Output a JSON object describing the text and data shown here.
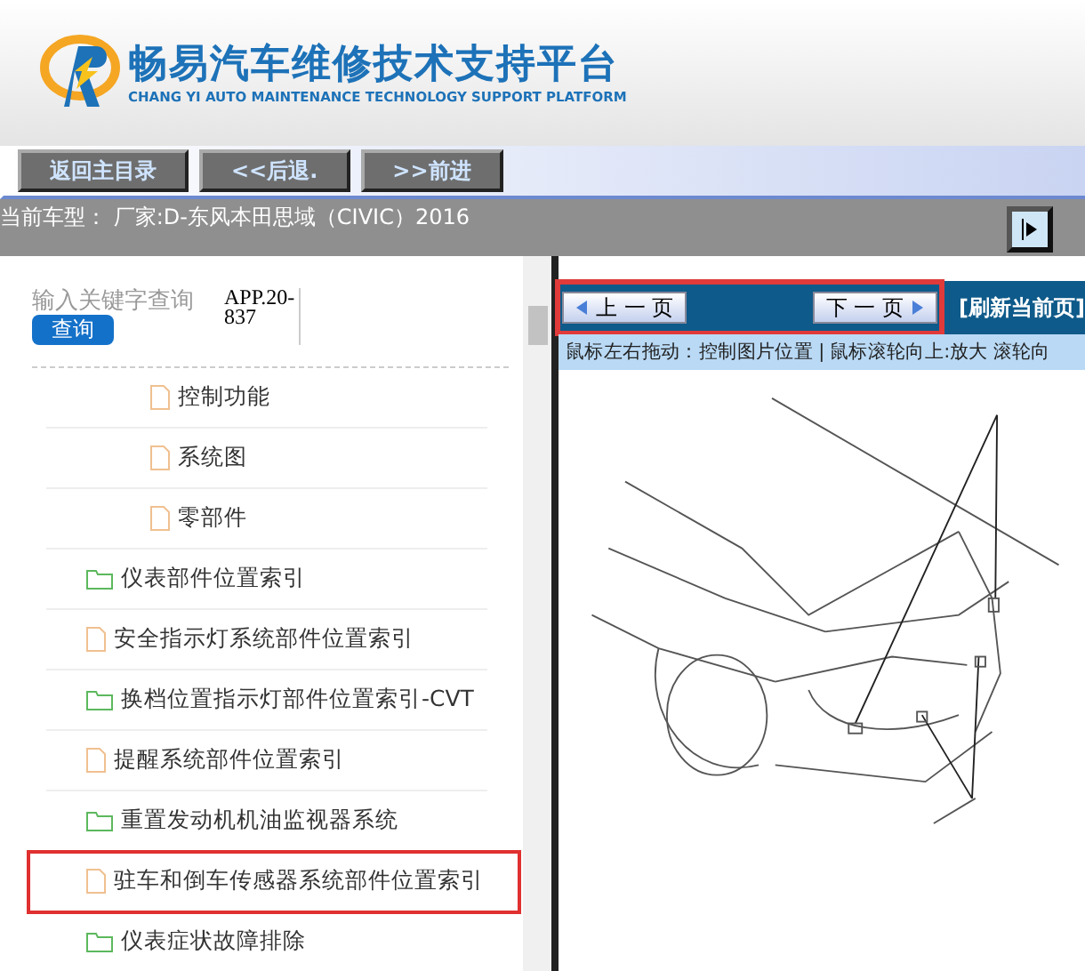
{
  "header": {
    "title": "畅易汽车维修技术支持平台",
    "subtitle": "CHANG YI AUTO MAINTENANCE TECHNOLOGY SUPPORT PLATFORM"
  },
  "toolbar": {
    "buttons": [
      "返回主目录",
      "<<后退.",
      ">>前进"
    ]
  },
  "vehicle_bar": {
    "text": "当前车型：  厂家:D-东风本田思域（CIVIC）2016"
  },
  "search": {
    "placeholder": "输入关键字查询",
    "button": "查询",
    "doc_code": "APP.20-837"
  },
  "tree": [
    {
      "kind": "group",
      "children": [
        {
          "kind": "file",
          "label": "控制功能",
          "highlighted": false
        },
        {
          "kind": "file",
          "label": "系统图",
          "highlighted": false
        },
        {
          "kind": "file",
          "label": "零部件",
          "highlighted": false
        }
      ]
    },
    {
      "kind": "folder",
      "label": "仪表部件位置索引",
      "highlighted": false
    },
    {
      "kind": "file",
      "label": "安全指示灯系统部件位置索引",
      "highlighted": false
    },
    {
      "kind": "folder",
      "label": "换档位置指示灯部件位置索引-CVT",
      "highlighted": false
    },
    {
      "kind": "file",
      "label": "提醒系统部件位置索引",
      "highlighted": false
    },
    {
      "kind": "folder",
      "label": "重置发动机机油监视器系统",
      "highlighted": false
    },
    {
      "kind": "file",
      "label": "驻车和倒车传感器系统部件位置索引",
      "highlighted": true
    },
    {
      "kind": "folder",
      "label": "仪表症状故障排除",
      "highlighted": false
    }
  ],
  "viewer": {
    "pager": {
      "prev": "上 一 页",
      "next": "下 一 页",
      "highlighted": true
    },
    "refresh": "[刷新当前页]",
    "hint": "鼠标左右拖动：控制图片位置 | 鼠标滚轮向上:放大   滚轮向"
  }
}
